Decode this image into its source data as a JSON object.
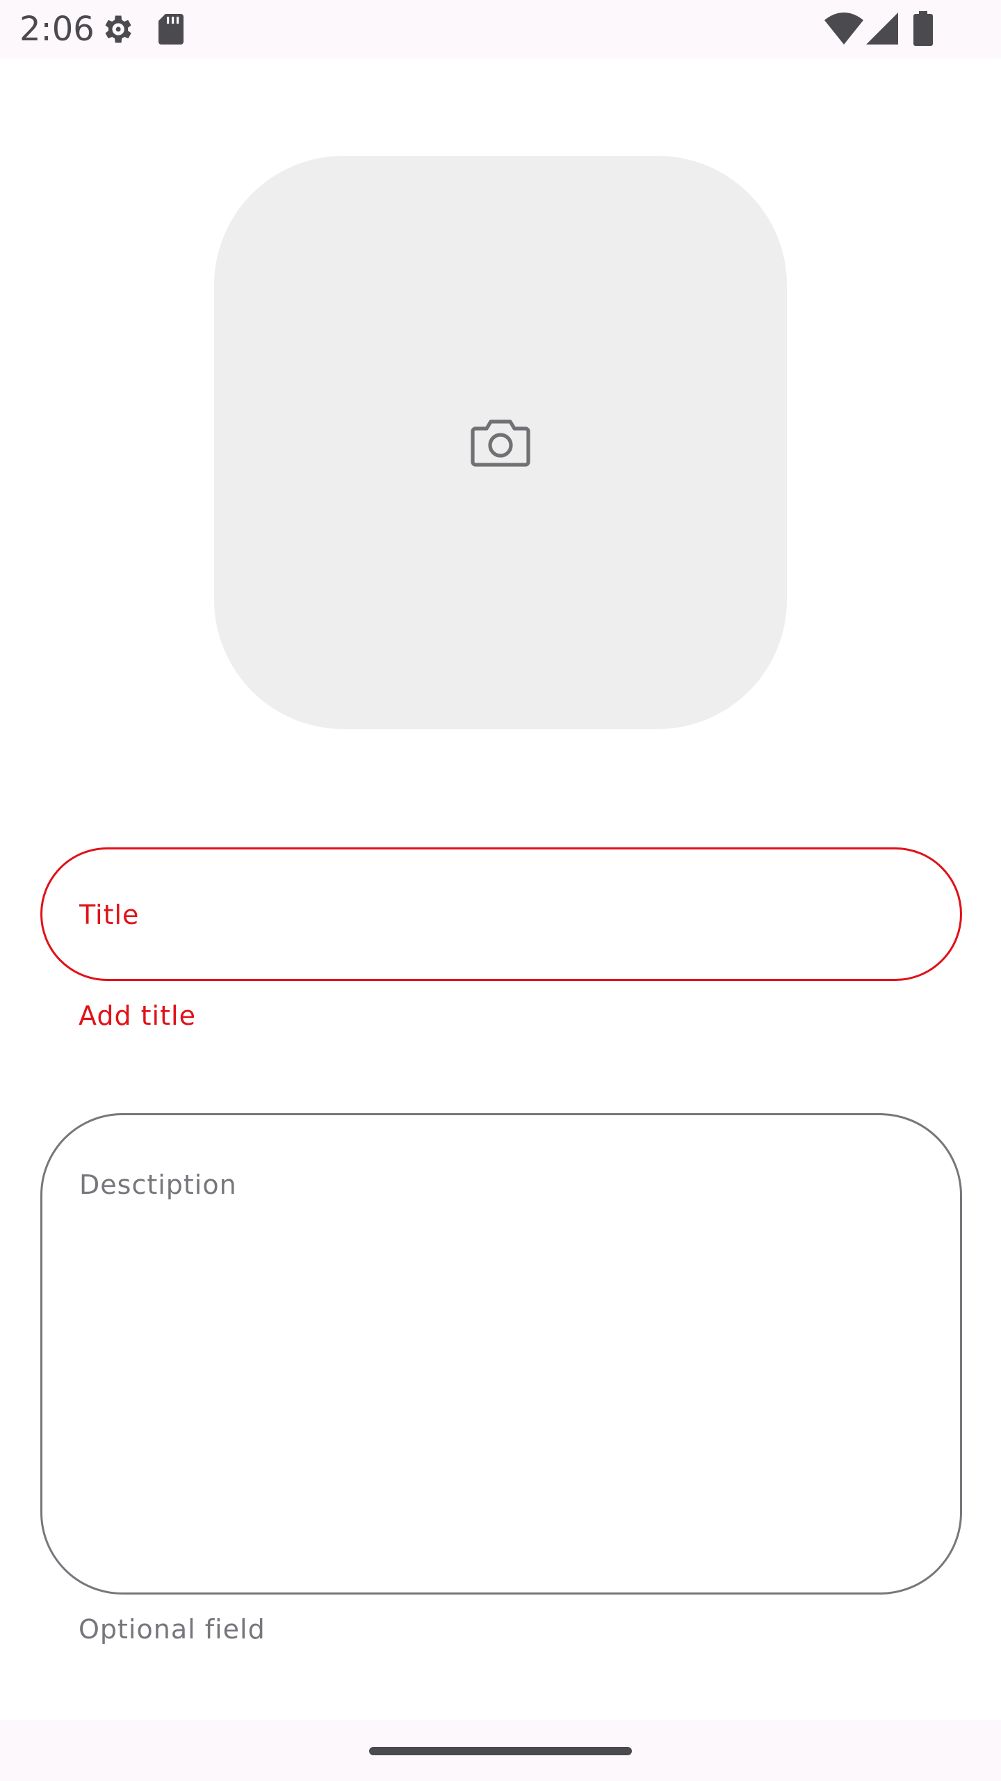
{
  "status_bar": {
    "time": "2:06",
    "left_icons": [
      "settings-gear-icon",
      "sd-card-icon"
    ],
    "right_icons": [
      "wifi-icon",
      "cell-signal-icon",
      "battery-icon"
    ]
  },
  "photo_picker": {
    "icon": "camera-icon"
  },
  "title_field": {
    "label": "Title",
    "value": "",
    "error_text": "Add title",
    "state": "error"
  },
  "description_field": {
    "label": "Desctiption",
    "value": "",
    "helper_text": "Optional field"
  },
  "colors": {
    "error": "#e01218",
    "outline": "#77767c",
    "photo_background": "#eeeeee",
    "system_bar": "#fdf8fc"
  }
}
